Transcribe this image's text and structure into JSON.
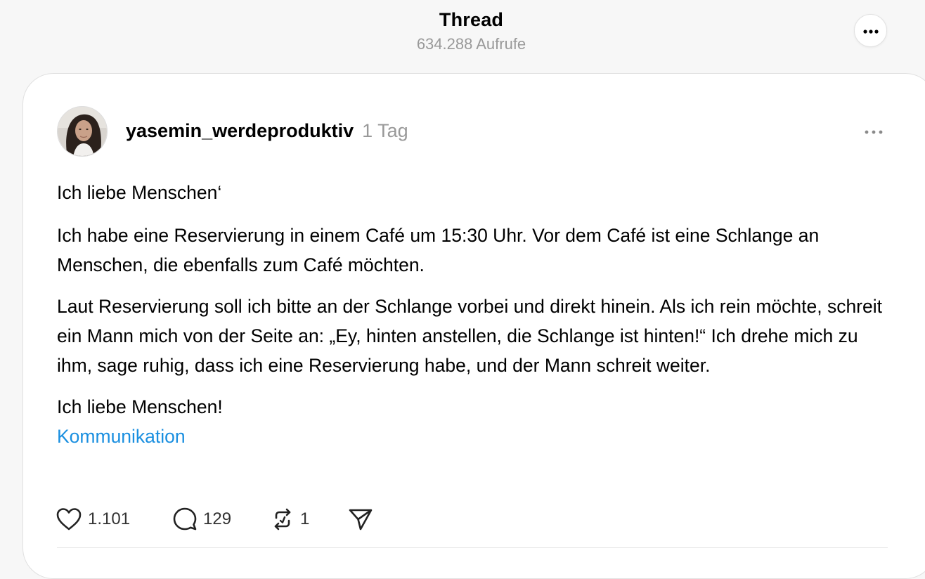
{
  "header": {
    "title": "Thread",
    "views": "634.288 Aufrufe",
    "more_icon": "more-horizontal-icon"
  },
  "post": {
    "author": "yasemin_werdeproduktiv",
    "time": "1 Tag",
    "paragraphs": [
      "Ich liebe Menschen‘",
      "Ich habe eine Reservierung in einem Café um 15:30 Uhr. Vor dem Café ist eine Schlange an Menschen, die ebenfalls zum Café möchten.",
      "Laut Reservierung soll ich bitte an der Schlange vorbei und direkt hinein. Als ich rein möchte, schreit ein Mann mich von der Seite an: „Ey, hinten anstellen, die Schlange ist hinten!“ Ich drehe mich zu ihm, sage ruhig, dass ich eine Reservierung habe, und der Mann schreit weiter.",
      "Ich liebe Menschen!"
    ],
    "tag": "Kommunikation",
    "tag_color": "#1a8fe0",
    "actions": {
      "likes": "1.101",
      "comments": "129",
      "reposts": "1"
    }
  }
}
